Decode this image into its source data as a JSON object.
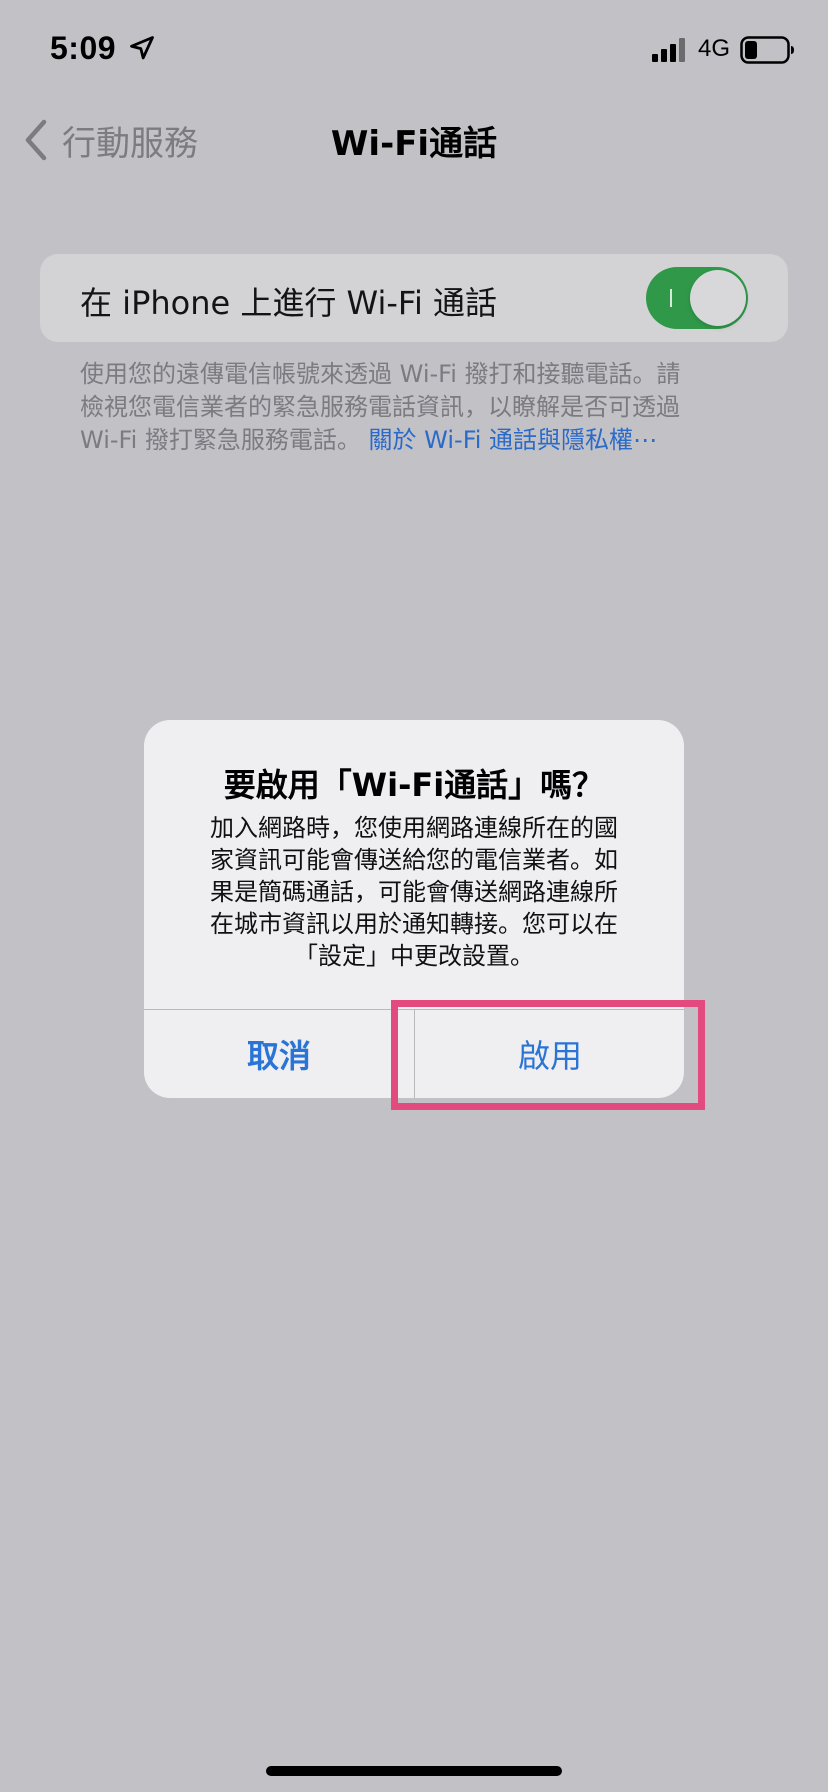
{
  "status_bar": {
    "time": "5:09",
    "network": "4G"
  },
  "nav": {
    "back_label": "行動服務",
    "title": "Wi-Fi通話"
  },
  "setting": {
    "label": "在 iPhone 上進行 Wi-Fi 通話",
    "toggle_on": true,
    "footer_lines": [
      "使用您的遠傳電信帳號來透過 Wi-Fi 撥打和接聽電話。請",
      "檢視您電信業者的緊急服務電話資訊，以瞭解是否可透過",
      "Wi-Fi 撥打緊急服務電話。"
    ],
    "footer_link": "關於 Wi-Fi 通話與隱私權⋯"
  },
  "alert": {
    "title": "要啟用「Wi-Fi通話」嗎？",
    "message_lines": [
      "加入網路時，您使用網路連線所在的國",
      "家資訊可能會傳送給您的電信業者。如",
      "果是簡碼通話，可能會傳送網路連線所",
      "在城市資訊以用於通知轉接。您可以在",
      "「設定」中更改設置。"
    ],
    "cancel_label": "取消",
    "enable_label": "啟用"
  },
  "colors": {
    "background": "#c2c1c6",
    "toggle_on": "#2f9949",
    "link_blue": "#2a6ac9",
    "highlight": "#e34b7f"
  },
  "icons": {
    "location": "location-arrow-icon",
    "signal": "cellular-signal-icon",
    "battery": "battery-icon",
    "back": "chevron-left-icon"
  }
}
